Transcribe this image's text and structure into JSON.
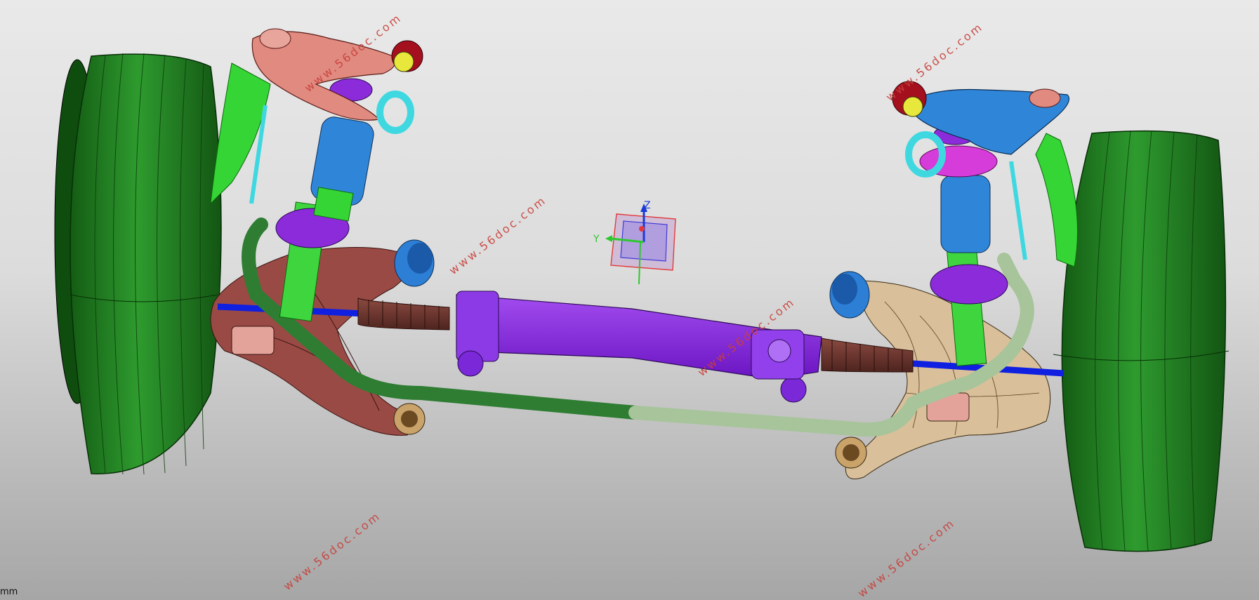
{
  "viewport": {
    "background_top": "#e9e9e9",
    "background_bottom": "#a6a6a6"
  },
  "triad": {
    "z_label": "Z",
    "y_label": "Y"
  },
  "watermark_text": "www.56doc.com",
  "status": {
    "unit_label": "mm"
  },
  "colors": {
    "tire": "#1f7a1f",
    "upper_arm_left": "#e08a80",
    "upper_arm_right": "#2f86d8",
    "steering_rack": "#8a2be2",
    "stabilizer_bar_left": "#2e7d32",
    "stabilizer_bar_right": "#a7c49a",
    "tie_rod": "#1020e0",
    "lower_arm_left": "#9a4a45",
    "lower_arm_right": "#d9c09a"
  }
}
